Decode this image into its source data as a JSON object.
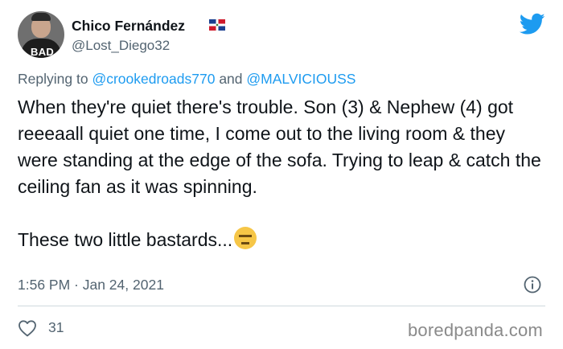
{
  "tweet": {
    "author_name": "Chico Fernández",
    "author_handle": "@Lost_Diego32",
    "avatar_shirt_text": "BAD",
    "reply_prefix": "Replying to",
    "reply_user1": "@crookedroads770",
    "reply_and": "and",
    "reply_user2": "@MALVICIOUSS",
    "text": "When they're quiet there's trouble. Son (3) & Nephew (4) got reeeaall quiet one time, I come out to the living room & they were standing at the edge of the sofa. Trying to leap & catch the ceiling fan as it was spinning.\n\nThese two little bastards...",
    "emoji": "expressionless-face-emoji",
    "timestamp": "1:56 PM · Jan 24, 2021",
    "like_count": "31"
  },
  "icons": {
    "brand": "twitter-bird-icon",
    "info": "info-icon",
    "like": "heart-icon",
    "flag": "dominican-republic-flag-icon"
  },
  "watermark": "boredpanda.com",
  "colors": {
    "link": "#1d9bf0",
    "twitter_blue": "#1d9bf0",
    "text": "#0f1419",
    "secondary": "#536471"
  }
}
